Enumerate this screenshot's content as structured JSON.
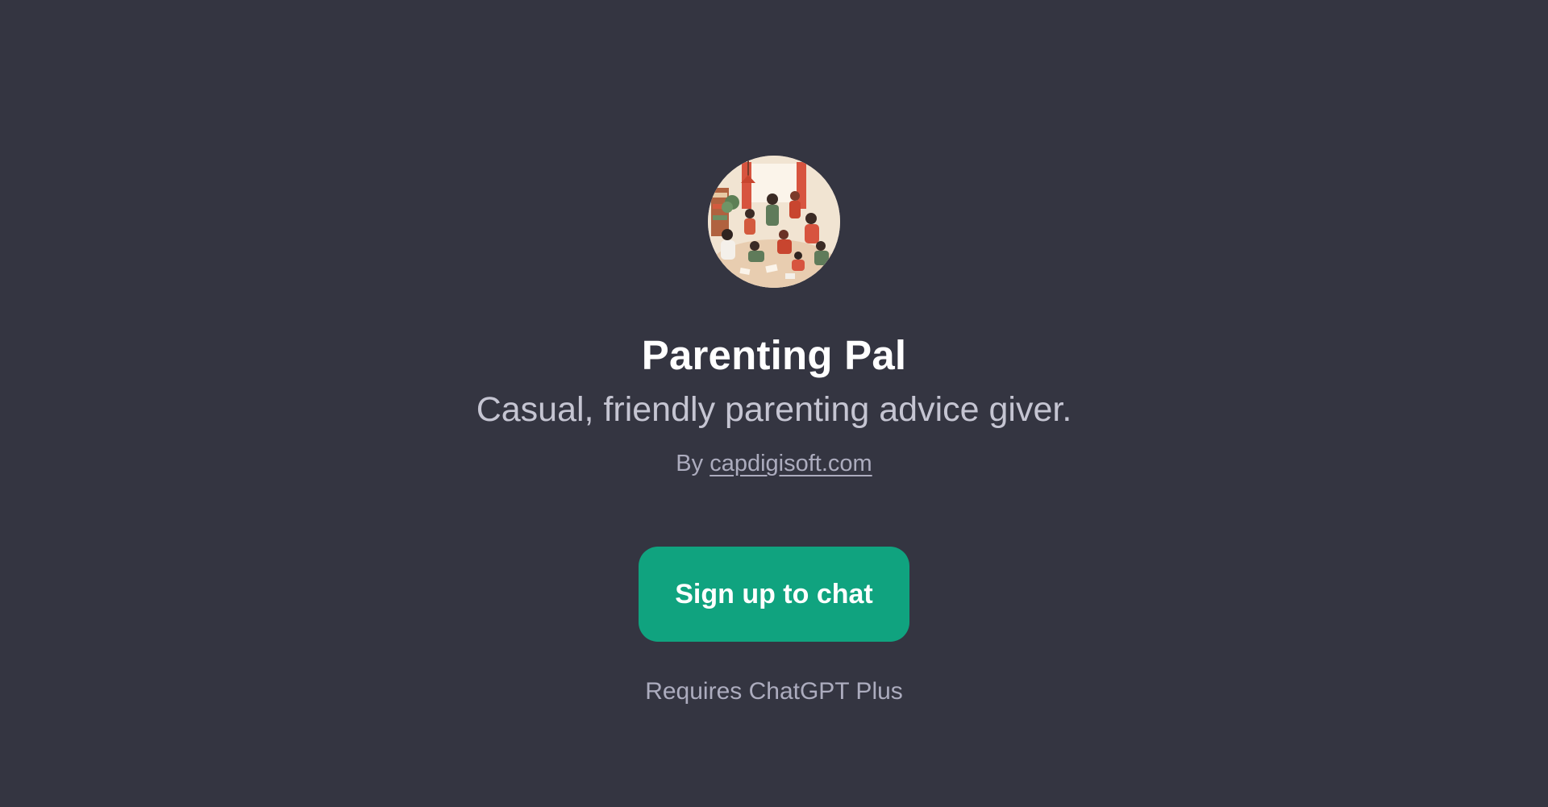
{
  "gpt": {
    "name": "Parenting Pal",
    "description": "Casual, friendly parenting advice giver.",
    "by_prefix": "By ",
    "author": "capdigisoft.com"
  },
  "cta": {
    "label": "Sign up to chat"
  },
  "requirement": "Requires ChatGPT Plus",
  "colors": {
    "background": "#343541",
    "accent": "#10a37f",
    "title": "#ffffff",
    "muted": "#acacbe"
  },
  "icons": {
    "avatar": "family-illustration-avatar"
  }
}
